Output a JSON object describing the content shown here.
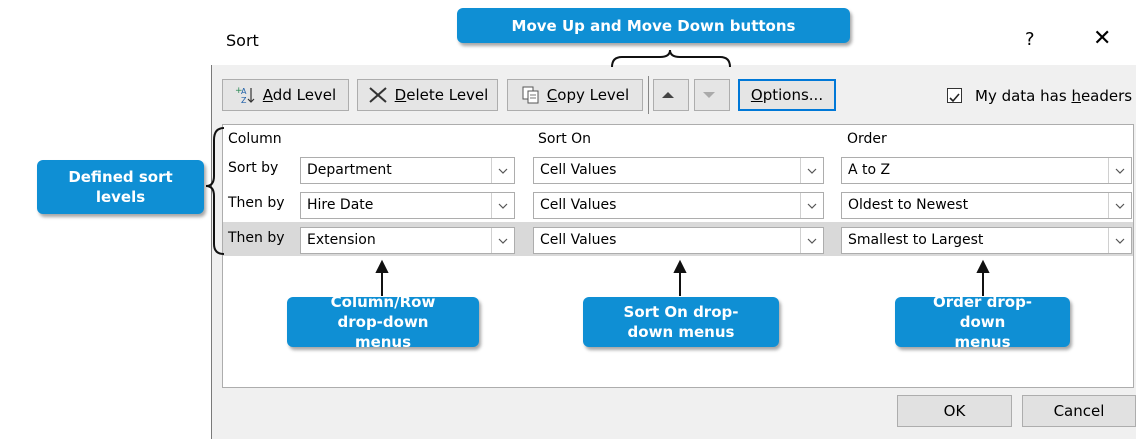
{
  "dialog": {
    "title": "Sort",
    "help": "?",
    "close": "✕"
  },
  "toolbar": {
    "add_level": {
      "prefix": "",
      "accel": "A",
      "rest": "dd Level"
    },
    "delete_level": {
      "accel": "D",
      "rest": "elete Level"
    },
    "copy_level": {
      "accel": "C",
      "rest": "opy Level"
    },
    "options": {
      "accel": "O",
      "rest": "ptions..."
    },
    "headers_checkbox": {
      "checked": true,
      "label_pre": "My data has ",
      "label_accel": "h",
      "label_post": "eaders"
    }
  },
  "grid": {
    "headers": {
      "column": "Column",
      "sort_on": "Sort On",
      "order": "Order"
    },
    "rows": [
      {
        "label": "Sort by",
        "column": "Department",
        "sort_on": "Cell Values",
        "order": "A to Z"
      },
      {
        "label": "Then by",
        "column": "Hire Date",
        "sort_on": "Cell Values",
        "order": "Oldest to Newest"
      },
      {
        "label": "Then by",
        "column": "Extension",
        "sort_on": "Cell Values",
        "order": "Smallest to Largest"
      }
    ]
  },
  "footer": {
    "ok": "OK",
    "cancel": "Cancel"
  },
  "callouts": {
    "move_buttons": "Move Up and Move Down buttons",
    "sort_levels": "Defined sort levels",
    "column_menus": "Column/Row drop-down menus",
    "sort_on_menus": "Sort On drop-down menus",
    "order_menus": "Order drop-down menus"
  },
  "colors": {
    "callout": "#0f8fd4",
    "focus": "#0078d7"
  }
}
